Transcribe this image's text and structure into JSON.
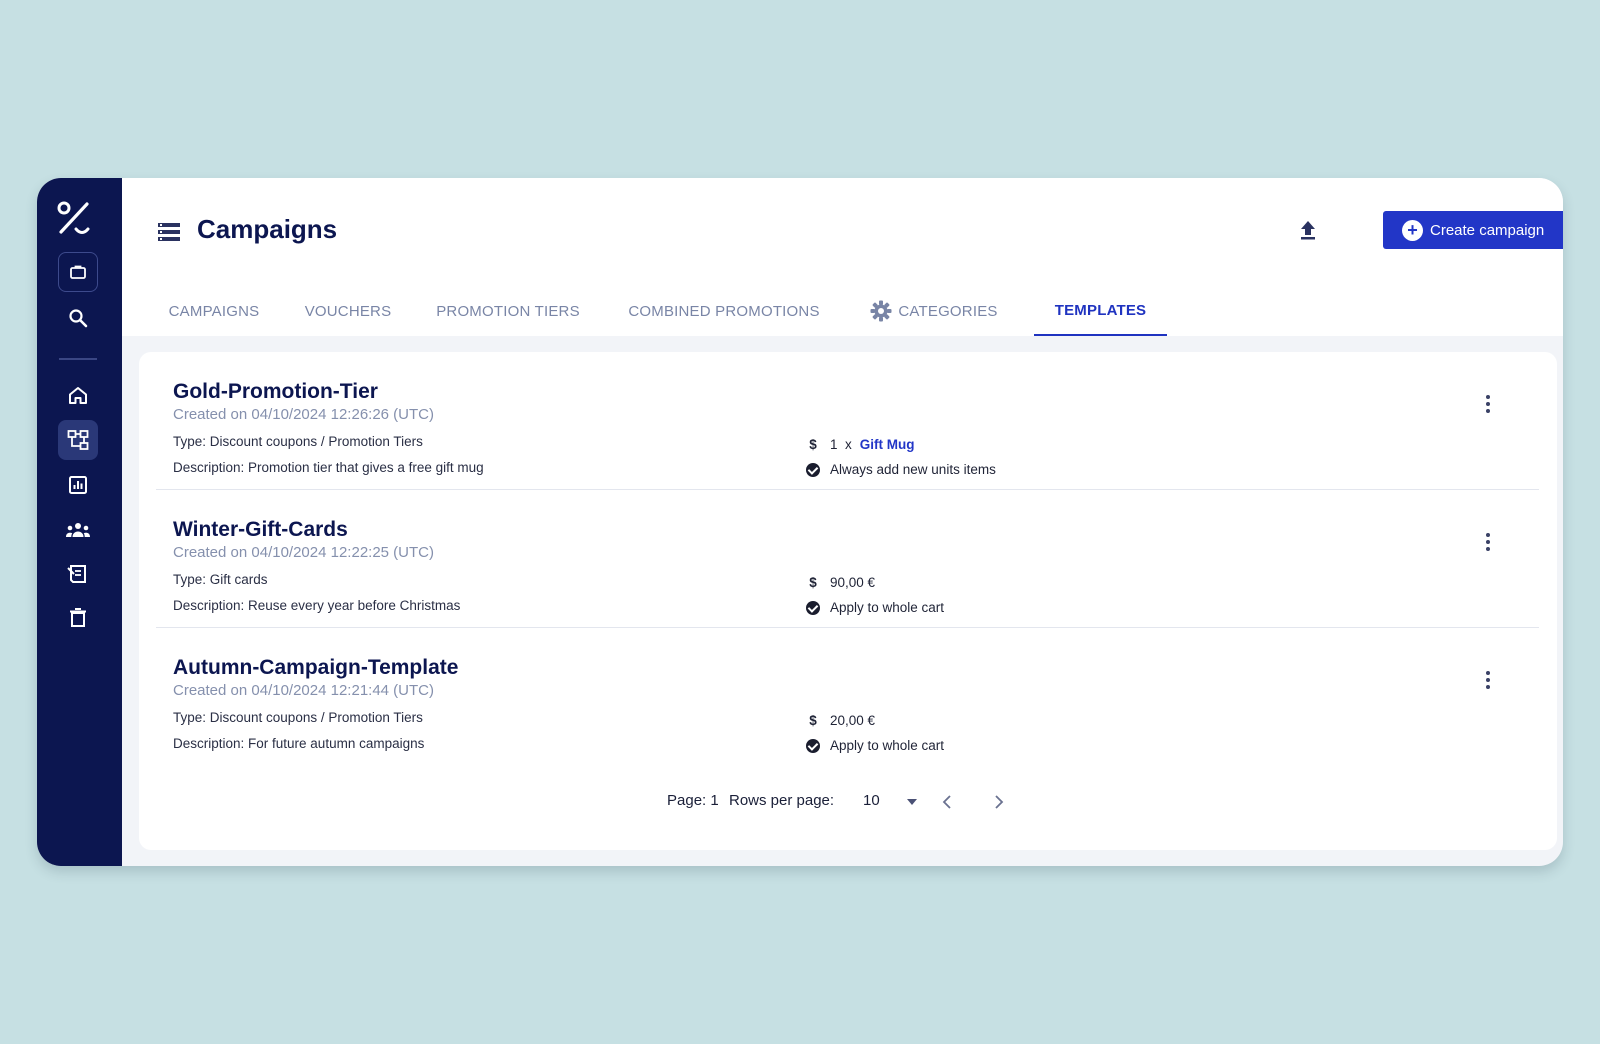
{
  "header": {
    "title": "Campaigns",
    "create_button": "Create campaign",
    "brand_color": "#2236c7",
    "sidebar_color": "#0c1650"
  },
  "tabs": [
    {
      "label": "CAMPAIGNS",
      "active": false
    },
    {
      "label": "VOUCHERS",
      "active": false
    },
    {
      "label": "PROMOTION TIERS",
      "active": false
    },
    {
      "label": "COMBINED PROMOTIONS",
      "active": false
    },
    {
      "label": "CATEGORIES",
      "active": false,
      "icon": "gear-icon"
    },
    {
      "label": "TEMPLATES",
      "active": true
    }
  ],
  "sidebar": {
    "items": [
      {
        "name": "briefcase-icon"
      },
      {
        "name": "search-icon"
      },
      {
        "name": "home-icon"
      },
      {
        "name": "campaigns-tree-icon",
        "active": true
      },
      {
        "name": "analytics-icon"
      },
      {
        "name": "audience-icon"
      },
      {
        "name": "export-doc-icon"
      },
      {
        "name": "trash-icon"
      }
    ]
  },
  "templates": [
    {
      "name": "Gold-Promotion-Tier",
      "created": "Created on 04/10/2024 12:26:26 (UTC)",
      "type": "Type: Discount coupons / Promotion Tiers",
      "description": "Description: Promotion tier that gives a free gift mug",
      "value_prefix": "1  x",
      "value_link": "Gift Mug",
      "value": "",
      "option": "Always add new units items"
    },
    {
      "name": "Winter-Gift-Cards",
      "created": "Created on 04/10/2024 12:22:25 (UTC)",
      "type": "Type: Gift cards",
      "description": "Description: Reuse every year before Christmas",
      "value": "90,00 €",
      "option": "Apply to whole cart"
    },
    {
      "name": "Autumn-Campaign-Template",
      "created": "Created on 04/10/2024 12:21:44 (UTC)",
      "type": "Type: Discount coupons / Promotion Tiers",
      "description": "Description: For future autumn campaigns",
      "value": "20,00 €",
      "option": "Apply to whole cart"
    }
  ],
  "pagination": {
    "page_label": "Page: 1",
    "rows_label": "Rows per page:",
    "rows_value": "10"
  },
  "symbols": {
    "dollar": "$"
  }
}
